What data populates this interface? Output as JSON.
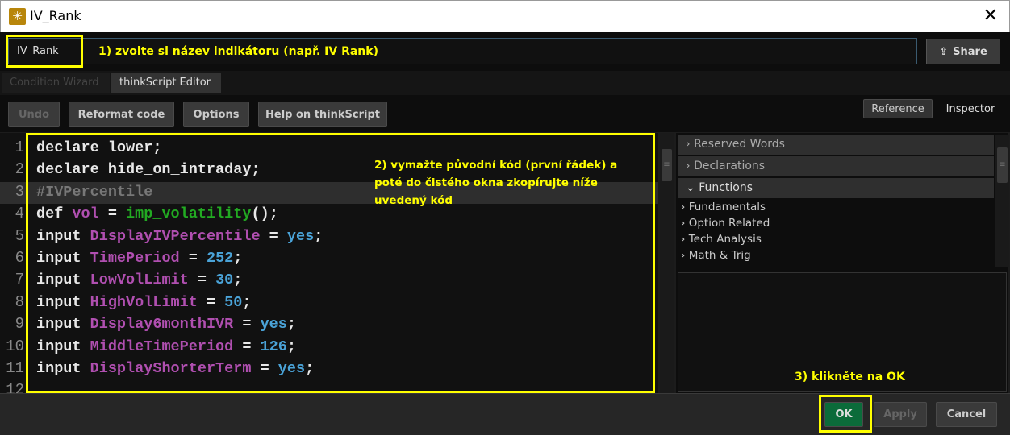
{
  "window": {
    "title": "IV_Rank",
    "icon": "thinkorswim-logo-icon",
    "close_icon": "close-icon"
  },
  "name_field": {
    "value": "IV_Rank"
  },
  "share": {
    "label": "Share",
    "icon": "share-icon"
  },
  "tabs": [
    {
      "label": "Condition Wizard",
      "active": false
    },
    {
      "label": "thinkScript Editor",
      "active": true
    }
  ],
  "toolbar": {
    "undo": "Undo",
    "reformat": "Reformat code",
    "options": "Options",
    "help": "Help on thinkScript"
  },
  "right_tabs": {
    "reference": "Reference",
    "inspector": "Inspector"
  },
  "code_lines": [
    {
      "n": "1",
      "tokens": [
        [
          "kw",
          "declare lower;"
        ]
      ]
    },
    {
      "n": "2",
      "tokens": [
        [
          "kw",
          "declare hide_on_intraday;"
        ]
      ]
    },
    {
      "n": "3",
      "tokens": [
        [
          "cm",
          "#IVPercentile"
        ]
      ]
    },
    {
      "n": "4",
      "tokens": [
        [
          "kw",
          "def "
        ],
        [
          "id",
          "vol"
        ],
        [
          "kw",
          " = "
        ],
        [
          "fn",
          "imp_volatility"
        ],
        [
          "kw",
          "();"
        ]
      ]
    },
    {
      "n": "5",
      "tokens": [
        [
          "kw",
          "input "
        ],
        [
          "id",
          "DisplayIVPercentile"
        ],
        [
          "kw",
          " = "
        ],
        [
          "num",
          "yes"
        ],
        [
          "kw",
          ";"
        ]
      ]
    },
    {
      "n": "6",
      "tokens": [
        [
          "kw",
          "input "
        ],
        [
          "id",
          "TimePeriod"
        ],
        [
          "kw",
          " = "
        ],
        [
          "num",
          "252"
        ],
        [
          "kw",
          ";"
        ]
      ]
    },
    {
      "n": "7",
      "tokens": [
        [
          "kw",
          "input "
        ],
        [
          "id",
          "LowVolLimit"
        ],
        [
          "kw",
          " = "
        ],
        [
          "num",
          "30"
        ],
        [
          "kw",
          ";"
        ]
      ]
    },
    {
      "n": "8",
      "tokens": [
        [
          "kw",
          "input "
        ],
        [
          "id",
          "HighVolLimit"
        ],
        [
          "kw",
          " = "
        ],
        [
          "num",
          "50"
        ],
        [
          "kw",
          ";"
        ]
      ]
    },
    {
      "n": "9",
      "tokens": [
        [
          "kw",
          "input "
        ],
        [
          "id",
          "Display6monthIVR"
        ],
        [
          "kw",
          " = "
        ],
        [
          "num",
          "yes"
        ],
        [
          "kw",
          ";"
        ]
      ]
    },
    {
      "n": "10",
      "tokens": [
        [
          "kw",
          "input "
        ],
        [
          "id",
          "MiddleTimePeriod"
        ],
        [
          "kw",
          " = "
        ],
        [
          "num",
          "126"
        ],
        [
          "kw",
          ";"
        ]
      ]
    },
    {
      "n": "11",
      "tokens": [
        [
          "kw",
          "input "
        ],
        [
          "id",
          "DisplayShorterTerm"
        ],
        [
          "kw",
          " = "
        ],
        [
          "num",
          "yes"
        ],
        [
          "kw",
          ";"
        ]
      ]
    },
    {
      "n": "12",
      "tokens": []
    }
  ],
  "reference": {
    "sections": [
      {
        "label": "Reserved Words",
        "expanded": false
      },
      {
        "label": "Declarations",
        "expanded": false
      },
      {
        "label": "Functions",
        "expanded": true
      }
    ],
    "function_items": [
      "Fundamentals",
      "Option Related",
      "Tech Analysis",
      "Math & Trig"
    ]
  },
  "annotations": {
    "step1": "1) zvolte si název indikátoru (např. IV Rank)",
    "step2": "2) vymažte původní kód (první řádek) a poté do čistého okna zkopírujte níže uvedený kód",
    "step3": "3) klikněte na OK",
    "color": "#ffff00"
  },
  "footer": {
    "ok": "OK",
    "apply": "Apply",
    "cancel": "Cancel",
    "ok_color": "#0b6b3a"
  }
}
